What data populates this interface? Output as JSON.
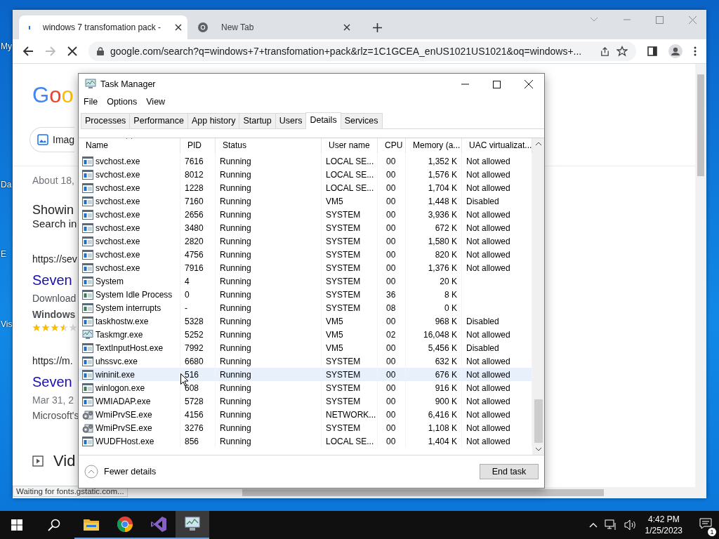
{
  "desktop": {
    "icons": [
      {
        "label": "My"
      },
      {
        "label": "Da"
      },
      {
        "label": "E"
      },
      {
        "label": "Vis"
      }
    ]
  },
  "browser": {
    "tabs": [
      {
        "title": "windows 7 transfomation pack -",
        "kind": "loading",
        "selected": true
      },
      {
        "title": "New Tab",
        "kind": "chrome",
        "selected": false
      }
    ],
    "url": "google.com/search?q=windows+7+transfomation+pack&rlz=1C1GCEA_enUS1021US1021&oq=windows+...",
    "page": [
      {
        "kind": "logo",
        "text": "Goo"
      },
      {
        "kind": "chip",
        "text": "Imag"
      },
      {
        "kind": "divider"
      },
      {
        "kind": "stats",
        "text": "About 18,"
      },
      {
        "kind": "heading",
        "text": "Showin"
      },
      {
        "kind": "subtext",
        "text": "Search in"
      },
      {
        "kind": "url",
        "text": "https://sev"
      },
      {
        "kind": "title",
        "text": "Seven"
      },
      {
        "kind": "snippet",
        "text": "Download"
      },
      {
        "kind": "bold",
        "text": "Windows"
      },
      {
        "kind": "stars",
        "stars": 3.5
      },
      {
        "kind": "url",
        "text": "https://m."
      },
      {
        "kind": "title",
        "text": "Seven"
      },
      {
        "kind": "date",
        "text": "Mar 31, 2"
      },
      {
        "kind": "snippet",
        "text": "Microsoft's"
      },
      {
        "kind": "section",
        "text": "Vid"
      }
    ],
    "status": "Waiting for fonts.gstatic.com..."
  },
  "task_manager": {
    "title": "Task Manager",
    "menu": [
      "File",
      "Options",
      "View"
    ],
    "tabs": [
      {
        "label": "Processes",
        "selected": false
      },
      {
        "label": "Performance",
        "selected": false
      },
      {
        "label": "App history",
        "selected": false
      },
      {
        "label": "Startup",
        "selected": false
      },
      {
        "label": "Users",
        "selected": false
      },
      {
        "label": "Details",
        "selected": true
      },
      {
        "label": "Services",
        "selected": false
      }
    ],
    "columns": [
      "Name",
      "PID",
      "Status",
      "User name",
      "CPU",
      "Memory (a...",
      "UAC virtualizat..."
    ],
    "rows": [
      {
        "kind": "service",
        "name": "svchost.exe",
        "pid": "7616",
        "status": "Running",
        "user": "LOCAL SE...",
        "cpu": "00",
        "memory": "1,352 K",
        "uac": "Not allowed",
        "selected": false
      },
      {
        "kind": "service",
        "name": "svchost.exe",
        "pid": "8012",
        "status": "Running",
        "user": "LOCAL SE...",
        "cpu": "00",
        "memory": "1,576 K",
        "uac": "Not allowed",
        "selected": false
      },
      {
        "kind": "service",
        "name": "svchost.exe",
        "pid": "1228",
        "status": "Running",
        "user": "LOCAL SE...",
        "cpu": "00",
        "memory": "1,704 K",
        "uac": "Not allowed",
        "selected": false
      },
      {
        "kind": "service",
        "name": "svchost.exe",
        "pid": "7160",
        "status": "Running",
        "user": "VM5",
        "cpu": "00",
        "memory": "1,448 K",
        "uac": "Disabled",
        "selected": false
      },
      {
        "kind": "service",
        "name": "svchost.exe",
        "pid": "2656",
        "status": "Running",
        "user": "SYSTEM",
        "cpu": "00",
        "memory": "3,936 K",
        "uac": "Not allowed",
        "selected": false
      },
      {
        "kind": "service",
        "name": "svchost.exe",
        "pid": "3480",
        "status": "Running",
        "user": "SYSTEM",
        "cpu": "00",
        "memory": "672 K",
        "uac": "Not allowed",
        "selected": false
      },
      {
        "kind": "service",
        "name": "svchost.exe",
        "pid": "2820",
        "status": "Running",
        "user": "SYSTEM",
        "cpu": "00",
        "memory": "1,580 K",
        "uac": "Not allowed",
        "selected": false
      },
      {
        "kind": "service",
        "name": "svchost.exe",
        "pid": "4756",
        "status": "Running",
        "user": "SYSTEM",
        "cpu": "00",
        "memory": "820 K",
        "uac": "Not allowed",
        "selected": false
      },
      {
        "kind": "service",
        "name": "svchost.exe",
        "pid": "7916",
        "status": "Running",
        "user": "SYSTEM",
        "cpu": "00",
        "memory": "1,376 K",
        "uac": "Not allowed",
        "selected": false
      },
      {
        "kind": "service",
        "name": "System",
        "pid": "4",
        "status": "Running",
        "user": "SYSTEM",
        "cpu": "00",
        "memory": "20 K",
        "selected": false
      },
      {
        "kind": "system",
        "name": "System Idle Process",
        "pid": "0",
        "status": "Running",
        "user": "SYSTEM",
        "cpu": "36",
        "memory": "8 K",
        "selected": false
      },
      {
        "kind": "system",
        "name": "System interrupts",
        "pid": "-",
        "status": "Running",
        "user": "SYSTEM",
        "cpu": "08",
        "memory": "0 K",
        "selected": false
      },
      {
        "kind": "service",
        "name": "taskhostw.exe",
        "pid": "5328",
        "status": "Running",
        "user": "VM5",
        "cpu": "00",
        "memory": "968 K",
        "uac": "Disabled",
        "selected": false
      },
      {
        "kind": "monitor",
        "name": "Taskmgr.exe",
        "pid": "5252",
        "status": "Running",
        "user": "VM5",
        "cpu": "02",
        "memory": "16,048 K",
        "uac": "Not allowed",
        "selected": false
      },
      {
        "kind": "service",
        "name": "TextInputHost.exe",
        "pid": "7992",
        "status": "Running",
        "user": "VM5",
        "cpu": "00",
        "memory": "5,456 K",
        "uac": "Disabled",
        "selected": false
      },
      {
        "kind": "service",
        "name": "uhssvc.exe",
        "pid": "6680",
        "status": "Running",
        "user": "SYSTEM",
        "cpu": "00",
        "memory": "632 K",
        "uac": "Not allowed",
        "selected": false
      },
      {
        "kind": "service",
        "name": "wininit.exe",
        "pid": "516",
        "status": "Running",
        "user": "SYSTEM",
        "cpu": "00",
        "memory": "676 K",
        "uac": "Not allowed",
        "selected": true
      },
      {
        "kind": "system",
        "name": "winlogon.exe",
        "pid": "608",
        "status": "Running",
        "user": "SYSTEM",
        "cpu": "00",
        "memory": "916 K",
        "uac": "Not allowed",
        "selected": false
      },
      {
        "kind": "service",
        "name": "WMIADAP.exe",
        "pid": "5728",
        "status": "Running",
        "user": "SYSTEM",
        "cpu": "00",
        "memory": "900 K",
        "uac": "Not allowed",
        "selected": false
      },
      {
        "kind": "gears",
        "name": "WmiPrvSE.exe",
        "pid": "4156",
        "status": "Running",
        "user": "NETWORK...",
        "cpu": "00",
        "memory": "6,416 K",
        "uac": "Not allowed",
        "selected": false
      },
      {
        "kind": "gears",
        "name": "WmiPrvSE.exe",
        "pid": "3276",
        "status": "Running",
        "user": "SYSTEM",
        "cpu": "00",
        "memory": "1,108 K",
        "uac": "Not allowed",
        "selected": false
      },
      {
        "kind": "service",
        "name": "WUDFHost.exe",
        "pid": "856",
        "status": "Running",
        "user": "LOCAL SE...",
        "cpu": "00",
        "memory": "1,404 K",
        "uac": "Not allowed",
        "selected": false
      }
    ],
    "fewer_details": "Fewer details",
    "end_task": "End task"
  },
  "taskbar": {
    "apps": [
      {
        "kind": "explorer",
        "selected": false
      },
      {
        "kind": "chrome",
        "selected": false
      },
      {
        "kind": "studio",
        "selected": false
      },
      {
        "kind": "monitor",
        "selected": true
      }
    ],
    "time": "4:42 PM",
    "date": "1/25/2023",
    "notifications": "1"
  }
}
